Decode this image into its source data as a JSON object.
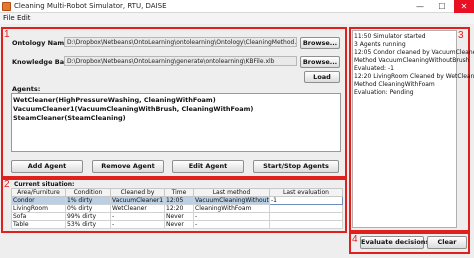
{
  "window": {
    "title": "Cleaning Multi-Robot Simulator, RTU, DAISE",
    "icon": "orange-app-icon",
    "controls": {
      "minimize": "—",
      "maximize": "☐",
      "close": "✕"
    }
  },
  "menu": {
    "items": [
      "File",
      "Edit"
    ]
  },
  "region_labels": {
    "r1": "1",
    "r2": "2",
    "r3": "3",
    "r4": "4"
  },
  "config": {
    "ontology_label": "Ontology Name:",
    "ontology_value": "D:\\Dropbox\\Netbeans\\OntoLearning\\ontolearning\\Ontology\\CleaningMethod.java",
    "kb_label": "Knowledge Base:",
    "kb_value": "D:\\Dropbox\\Netbeans\\OntoLearning\\generate\\ontolearning\\KBFile.xlb",
    "browse_label": "Browse...",
    "load_label": "Load"
  },
  "agents": {
    "label": "Agents:",
    "items": [
      "WetCleaner(HighPressureWashing, CleaningWithFoam)",
      "VacuumCleaner1(VacuumCleaningWithBrush, CleaningWithFoam)",
      "SteamCleaner(SteamCleaning)"
    ]
  },
  "agent_buttons": {
    "add": "Add Agent",
    "remove": "Remove Agent",
    "edit": "Edit Agent",
    "start_stop": "Start/Stop Agents"
  },
  "situation": {
    "label": "Current situation:",
    "columns": [
      "Area/Furniture",
      "Condition",
      "Cleaned by",
      "Time",
      "Last method",
      "Last evaluation"
    ],
    "rows": [
      [
        "Condor",
        "1% dirty",
        "VacuumCleaner1",
        "12:05",
        "VacuumCleaningWithout...",
        "-1"
      ],
      [
        "LivingRoom",
        "0% dirty",
        "WetCleaner",
        "12:20",
        "CleaningWithFoam",
        ""
      ],
      [
        "Sofa",
        "99% dirty",
        "-",
        "Never",
        "-",
        ""
      ],
      [
        "Table",
        "53% dirty",
        "-",
        "Never",
        "-",
        ""
      ]
    ]
  },
  "log": {
    "lines": [
      "11:50 Simulator started",
      "    3 Agents running",
      "12:05 Condor cleaned by VacuumCleaner1,",
      "    Method VacuumCleaningWithoutBrush",
      "    Evaluated: -1",
      "12:20 LivingRoom Cleaned by WetCleaner",
      "    Method CleaningWithFoam",
      "    Evaluation: Pending"
    ]
  },
  "actions": {
    "evaluate": "Evaluate decisions",
    "clear": "Clear"
  },
  "colors": {
    "region_border": "#e0201c",
    "close_button": "#e81123",
    "selection": "#b8cfe5"
  }
}
